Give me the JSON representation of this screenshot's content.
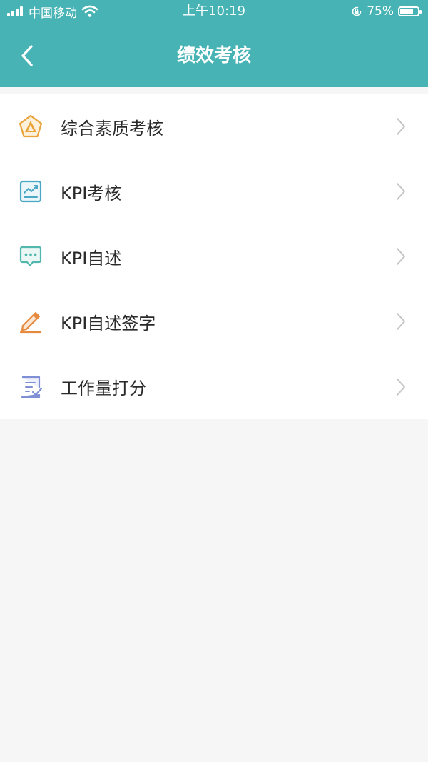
{
  "status_bar": {
    "carrier": "中国移动",
    "time": "上午10:19",
    "battery_percent": "75%",
    "battery_level": 0.75
  },
  "header": {
    "title": "绩效考核",
    "background_color": "#47b3b4"
  },
  "menu": {
    "items": [
      {
        "label": "综合素质考核",
        "icon": "pentagon-badge-icon",
        "color": "#e9a33b"
      },
      {
        "label": "KPI考核",
        "icon": "chart-board-icon",
        "color": "#4aa8c4"
      },
      {
        "label": "KPI自述",
        "icon": "chat-bubble-icon",
        "color": "#52b8ad"
      },
      {
        "label": "KPI自述签字",
        "icon": "pen-sign-icon",
        "color": "#e58a3e"
      },
      {
        "label": "工作量打分",
        "icon": "checklist-icon",
        "color": "#7f8fd6"
      }
    ]
  }
}
